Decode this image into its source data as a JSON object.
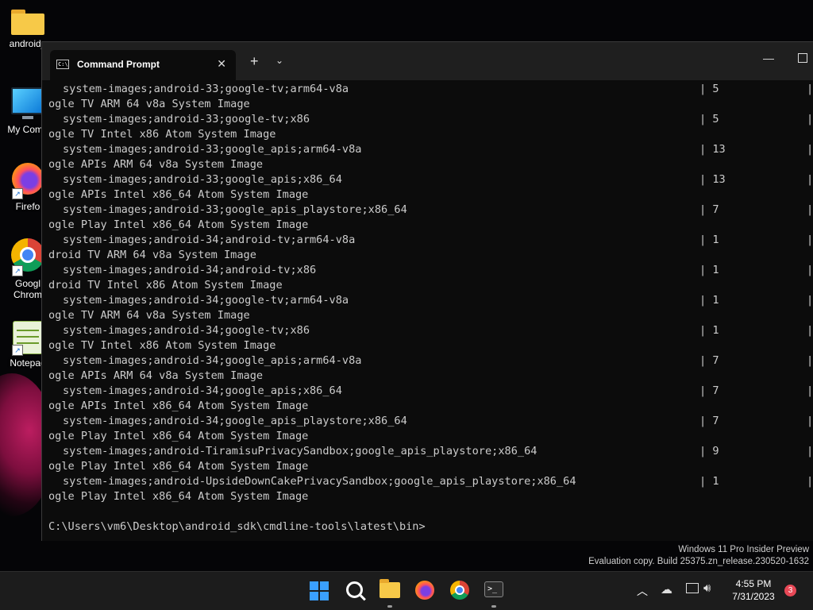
{
  "desktop": {
    "icons": [
      {
        "label": "android_",
        "icon": "folder-icon"
      },
      {
        "label": "My Comp",
        "icon": "computer-icon"
      },
      {
        "label": "Firefo",
        "icon": "firefox-icon"
      },
      {
        "label": "Googl",
        "label2": "Chrom",
        "icon": "chrome-icon"
      },
      {
        "label": "Notepad",
        "icon": "notepad-icon"
      }
    ]
  },
  "window": {
    "tab_title": "Command Prompt",
    "new_tab_symbol": "+",
    "dropdown_symbol": "⌄",
    "close_symbol": "✕",
    "minimize_symbol": "—"
  },
  "console": {
    "rows": [
      {
        "pkg": "system-images;android-33;google-tv;arm64-v8a",
        "ver": "5",
        "desc": "ogle TV ARM 64 v8a System Image"
      },
      {
        "pkg": "system-images;android-33;google-tv;x86",
        "ver": "5",
        "desc": "ogle TV Intel x86 Atom System Image"
      },
      {
        "pkg": "system-images;android-33;google_apis;arm64-v8a",
        "ver": "13",
        "desc": "ogle APIs ARM 64 v8a System Image"
      },
      {
        "pkg": "system-images;android-33;google_apis;x86_64",
        "ver": "13",
        "desc": "ogle APIs Intel x86_64 Atom System Image"
      },
      {
        "pkg": "system-images;android-33;google_apis_playstore;x86_64",
        "ver": "7",
        "desc": "ogle Play Intel x86_64 Atom System Image"
      },
      {
        "pkg": "system-images;android-34;android-tv;arm64-v8a",
        "ver": "1",
        "desc": "droid TV ARM 64 v8a System Image"
      },
      {
        "pkg": "system-images;android-34;android-tv;x86",
        "ver": "1",
        "desc": "droid TV Intel x86 Atom System Image"
      },
      {
        "pkg": "system-images;android-34;google-tv;arm64-v8a",
        "ver": "1",
        "desc": "ogle TV ARM 64 v8a System Image"
      },
      {
        "pkg": "system-images;android-34;google-tv;x86",
        "ver": "1",
        "desc": "ogle TV Intel x86 Atom System Image"
      },
      {
        "pkg": "system-images;android-34;google_apis;arm64-v8a",
        "ver": "7",
        "desc": "ogle APIs ARM 64 v8a System Image"
      },
      {
        "pkg": "system-images;android-34;google_apis;x86_64",
        "ver": "7",
        "desc": "ogle APIs Intel x86_64 Atom System Image"
      },
      {
        "pkg": "system-images;android-34;google_apis_playstore;x86_64",
        "ver": "7",
        "desc": "ogle Play Intel x86_64 Atom System Image"
      },
      {
        "pkg": "system-images;android-TiramisuPrivacySandbox;google_apis_playstore;x86_64",
        "ver": "9",
        "desc": "ogle Play Intel x86_64 Atom System Image"
      },
      {
        "pkg": "system-images;android-UpsideDownCakePrivacySandbox;google_apis_playstore;x86_64",
        "ver": "1",
        "desc": "ogle Play Intel x86_64 Atom System Image"
      }
    ],
    "separator": "|",
    "prompt": "C:\\Users\\vm6\\Desktop\\android_sdk\\cmdline-tools\\latest\\bin>"
  },
  "watermark": {
    "line1": "Windows 11 Pro Insider Preview",
    "line2": "Evaluation copy. Build 25375.zn_release.230520-1632"
  },
  "taskbar": {
    "time": "4:55 PM",
    "date": "7/31/2023",
    "notification_count": "3"
  }
}
